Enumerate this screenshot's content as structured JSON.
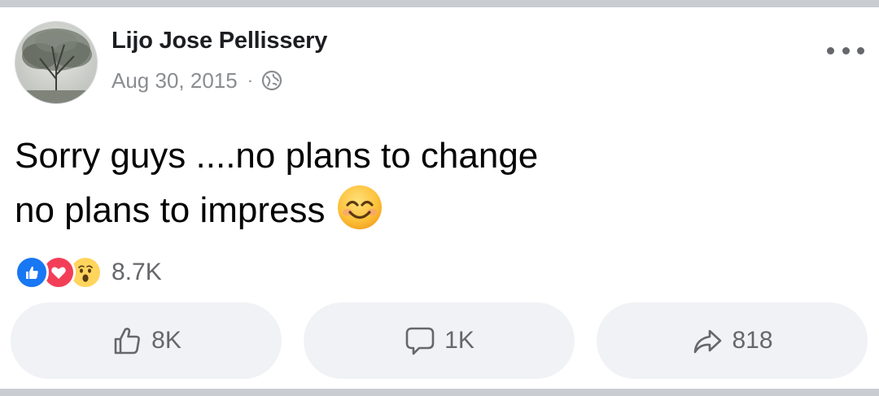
{
  "post": {
    "author": "Lijo Jose Pellissery",
    "date": "Aug 30, 2015",
    "separator": "·",
    "privacy_icon": "globe-icon",
    "text_line1": "Sorry guys ....no plans to change",
    "text_line2": "no plans to impress",
    "emoji": "smiling-face-with-smiling-eyes"
  },
  "reactions": {
    "types": [
      "like",
      "love",
      "wow"
    ],
    "count": "8.7K"
  },
  "actions": {
    "like_count": "8K",
    "comment_count": "1K",
    "share_count": "818"
  },
  "colors": {
    "like_blue": "#1877f2",
    "love_red": "#f33e58",
    "wow_yellow": "#ffd55e",
    "button_bg": "#f0f2f5",
    "muted_text": "#65676b",
    "divider": "#c9ccd1"
  }
}
